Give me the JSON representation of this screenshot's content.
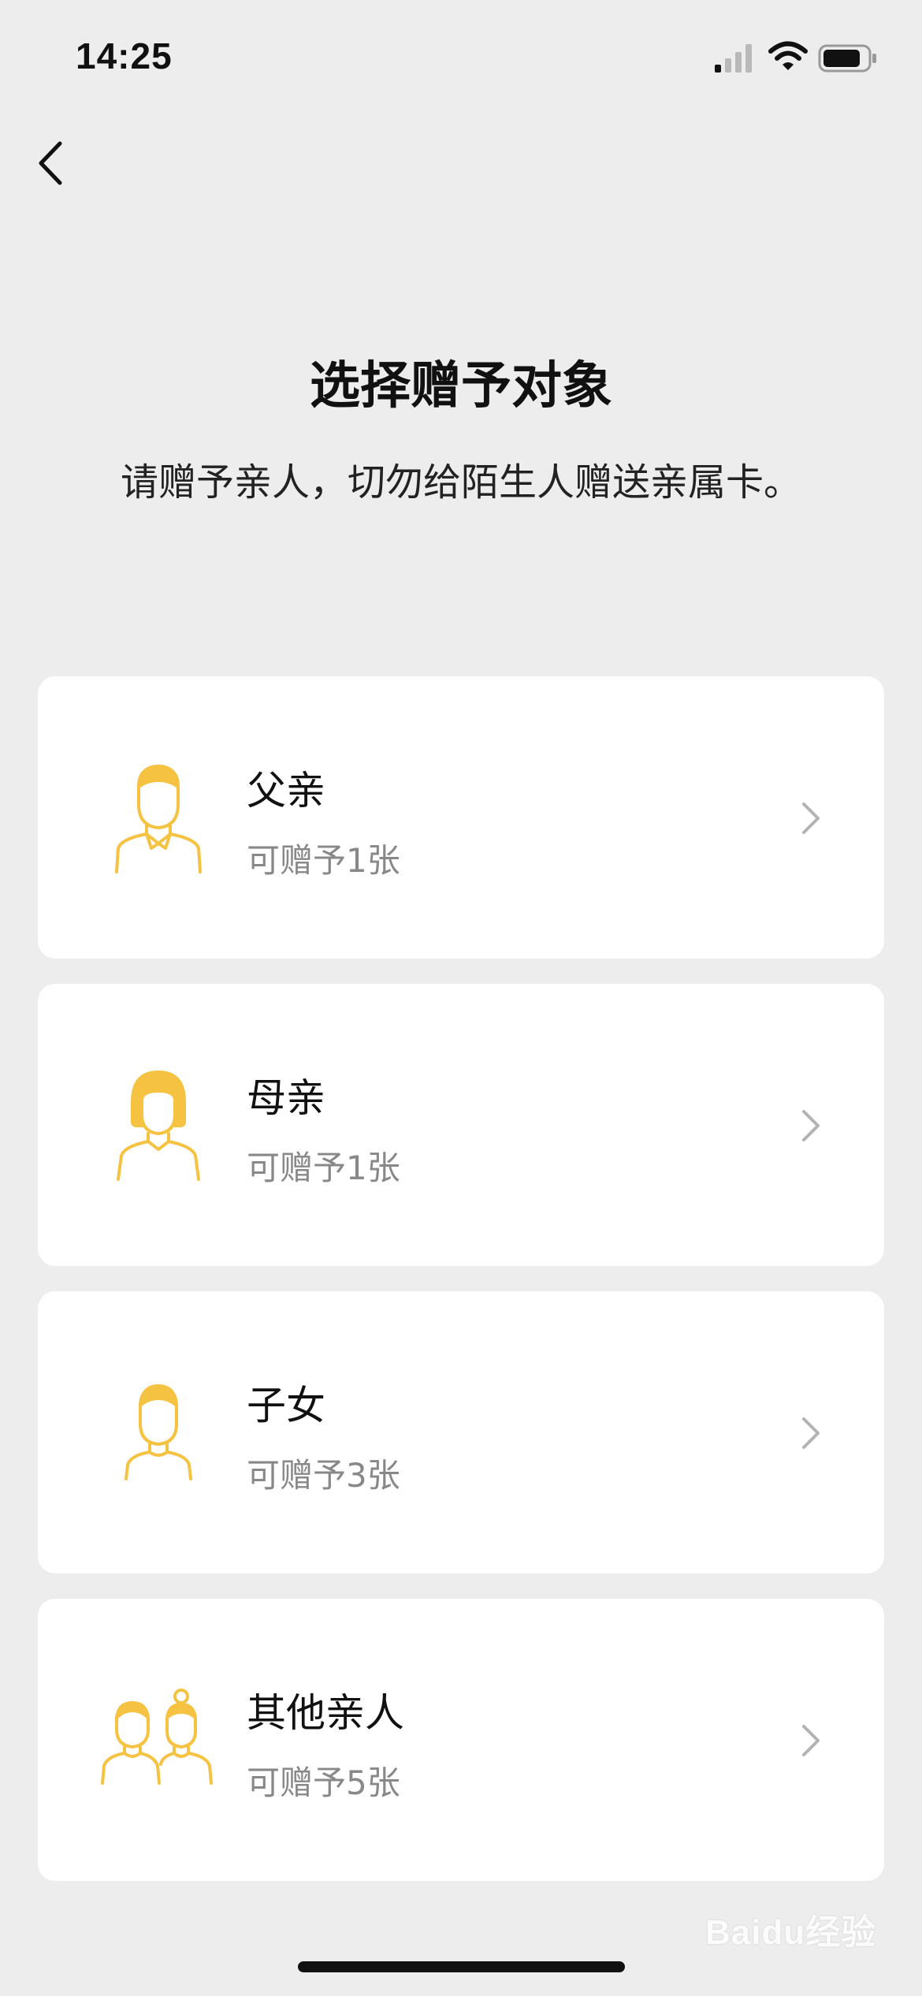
{
  "status_bar": {
    "time": "14:25",
    "icons": [
      "signal-icon",
      "wifi-icon",
      "battery-icon"
    ]
  },
  "nav": {
    "back_icon": "chevron-left-icon"
  },
  "header": {
    "title": "选择赠予对象",
    "subtitle": "请赠予亲人，切勿给陌生人赠送亲属卡。"
  },
  "colors": {
    "accent": "#F5C242",
    "background": "#EDEDED",
    "card": "#FFFFFF",
    "secondary_text": "#888888"
  },
  "recipients": [
    {
      "name": "父亲",
      "quota": "可赠予1张",
      "icon": "father-icon"
    },
    {
      "name": "母亲",
      "quota": "可赠予1张",
      "icon": "mother-icon"
    },
    {
      "name": "子女",
      "quota": "可赠予3张",
      "icon": "child-icon"
    },
    {
      "name": "其他亲人",
      "quota": "可赠予5张",
      "icon": "relatives-icon"
    }
  ],
  "watermark": "Baidu经验"
}
